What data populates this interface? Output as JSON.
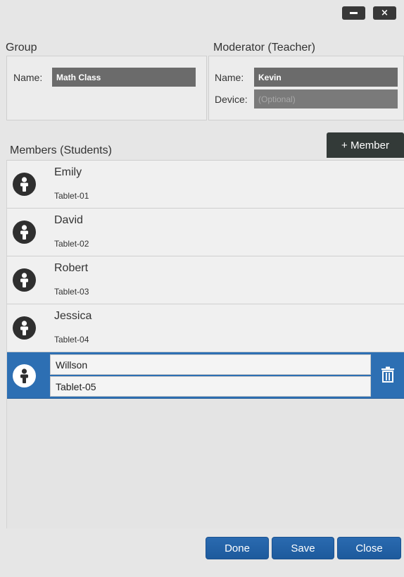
{
  "window": {
    "minimize_icon": "minimize-icon",
    "close_label": "×"
  },
  "group": {
    "title": "Group",
    "name_label": "Name:",
    "name_value": "Math Class"
  },
  "moderator": {
    "title": "Moderator (Teacher)",
    "name_label": "Name:",
    "name_value": "Kevin",
    "device_label": "Device:",
    "device_placeholder": "(Optional)"
  },
  "members": {
    "title": "Members (Students)",
    "add_button": "+ Member",
    "items": [
      {
        "name": "Emily",
        "device": "Tablet-01"
      },
      {
        "name": "David",
        "device": "Tablet-02"
      },
      {
        "name": "Robert",
        "device": "Tablet-03"
      },
      {
        "name": "Jessica",
        "device": "Tablet-04"
      },
      {
        "name": "Willson",
        "device": "Tablet-05",
        "selected": true
      }
    ]
  },
  "footer": {
    "done": "Done",
    "save": "Save",
    "close": "Close"
  },
  "colors": {
    "accent": "#2d6fb3",
    "dark_button": "#333a38",
    "field": "#6b6b6b"
  }
}
